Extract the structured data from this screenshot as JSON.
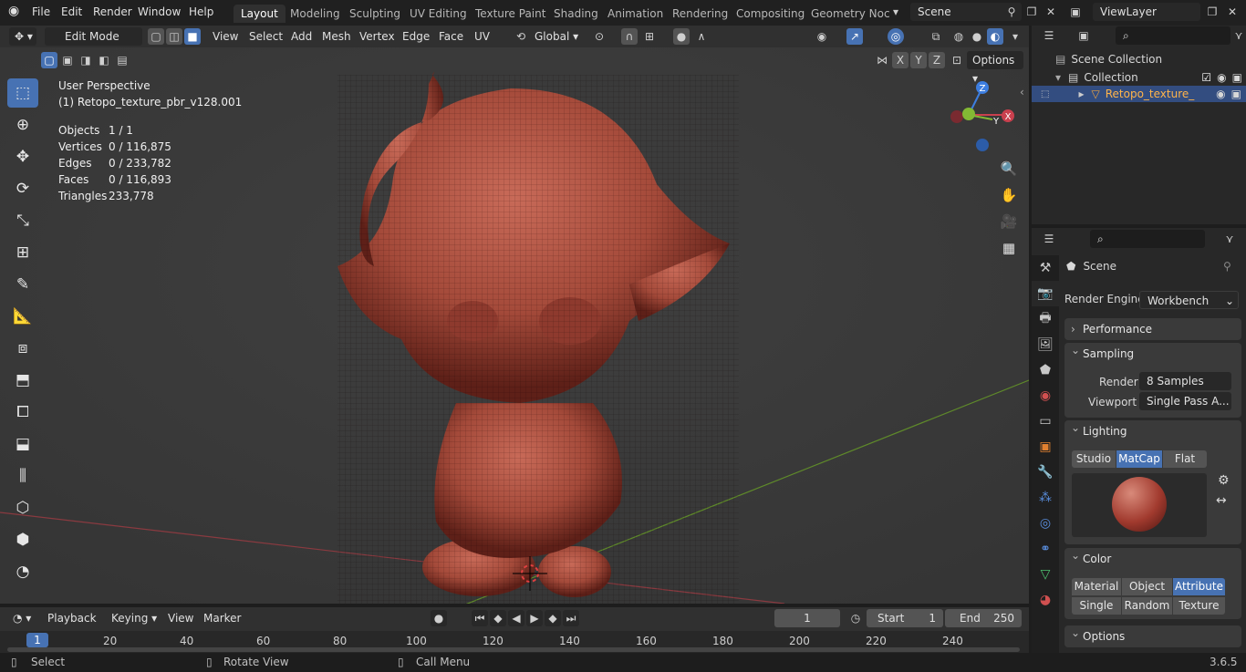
{
  "menu": {
    "logo": "blender-icon",
    "file": "File",
    "edit": "Edit",
    "render": "Render",
    "window": "Window",
    "help": "Help"
  },
  "workspaces": [
    "Layout",
    "Modeling",
    "Sculpting",
    "UV Editing",
    "Texture Paint",
    "Shading",
    "Animation",
    "Rendering",
    "Compositing",
    "Geometry Noc"
  ],
  "scene_field": "Scene",
  "viewlayer_field": "ViewLayer",
  "header": {
    "mode": "Edit Mode",
    "view": "View",
    "select": "Select",
    "add": "Add",
    "mesh": "Mesh",
    "vertex": "Vertex",
    "edge": "Edge",
    "face": "Face",
    "uv": "UV",
    "orientation": "Global",
    "options": "Options",
    "axes": [
      "X",
      "Y",
      "Z"
    ]
  },
  "overlay_text": {
    "perspective": "User Perspective",
    "object_name": "(1) Retopo_texture_pbr_v128.001",
    "stats": [
      {
        "label": "Objects",
        "value": "1 / 1"
      },
      {
        "label": "Vertices",
        "value": "0 / 116,875"
      },
      {
        "label": "Edges",
        "value": "0 / 233,782"
      },
      {
        "label": "Faces",
        "value": "0 / 116,893"
      },
      {
        "label": "Triangles",
        "value": "233,778"
      }
    ]
  },
  "gizmo": {
    "x": "X",
    "y": "Y",
    "z": "Z"
  },
  "outliner": {
    "scene_collection": "Scene Collection",
    "collection": "Collection",
    "object": "Retopo_texture_"
  },
  "properties": {
    "scene": "Scene",
    "render_engine_label": "Render Engine",
    "render_engine": "Workbench",
    "performance": "Performance",
    "sampling": "Sampling",
    "render_label": "Render",
    "render_samples": "8 Samples",
    "viewport_label": "Viewport",
    "viewport_samples": "Single Pass A...",
    "lighting": "Lighting",
    "lighting_modes": [
      "Studio",
      "MatCap",
      "Flat"
    ],
    "lighting_active": "MatCap",
    "color": "Color",
    "color_modes": [
      "Material",
      "Object",
      "Attribute",
      "Single",
      "Random",
      "Texture"
    ],
    "color_active": "Attribute",
    "options": "Options"
  },
  "timeline": {
    "playback": "Playback",
    "keying": "Keying",
    "view": "View",
    "marker": "Marker",
    "current_frame": "1",
    "start_label": "Start",
    "start": "1",
    "end_label": "End",
    "end": "250",
    "ticks": [
      "1",
      "20",
      "40",
      "60",
      "80",
      "100",
      "120",
      "140",
      "160",
      "180",
      "200",
      "220",
      "240"
    ]
  },
  "status": {
    "select": "Select",
    "rotate": "Rotate View",
    "call_menu": "Call Menu",
    "version": "3.6.5"
  },
  "colors": {
    "accent": "#4772b3",
    "bg": "#1d1d1d",
    "viewport": "#3c3c3c",
    "model": "#a84a3c",
    "x_axis": "#c9404e",
    "y_axis": "#83b834",
    "z_axis": "#3d7ee0"
  }
}
